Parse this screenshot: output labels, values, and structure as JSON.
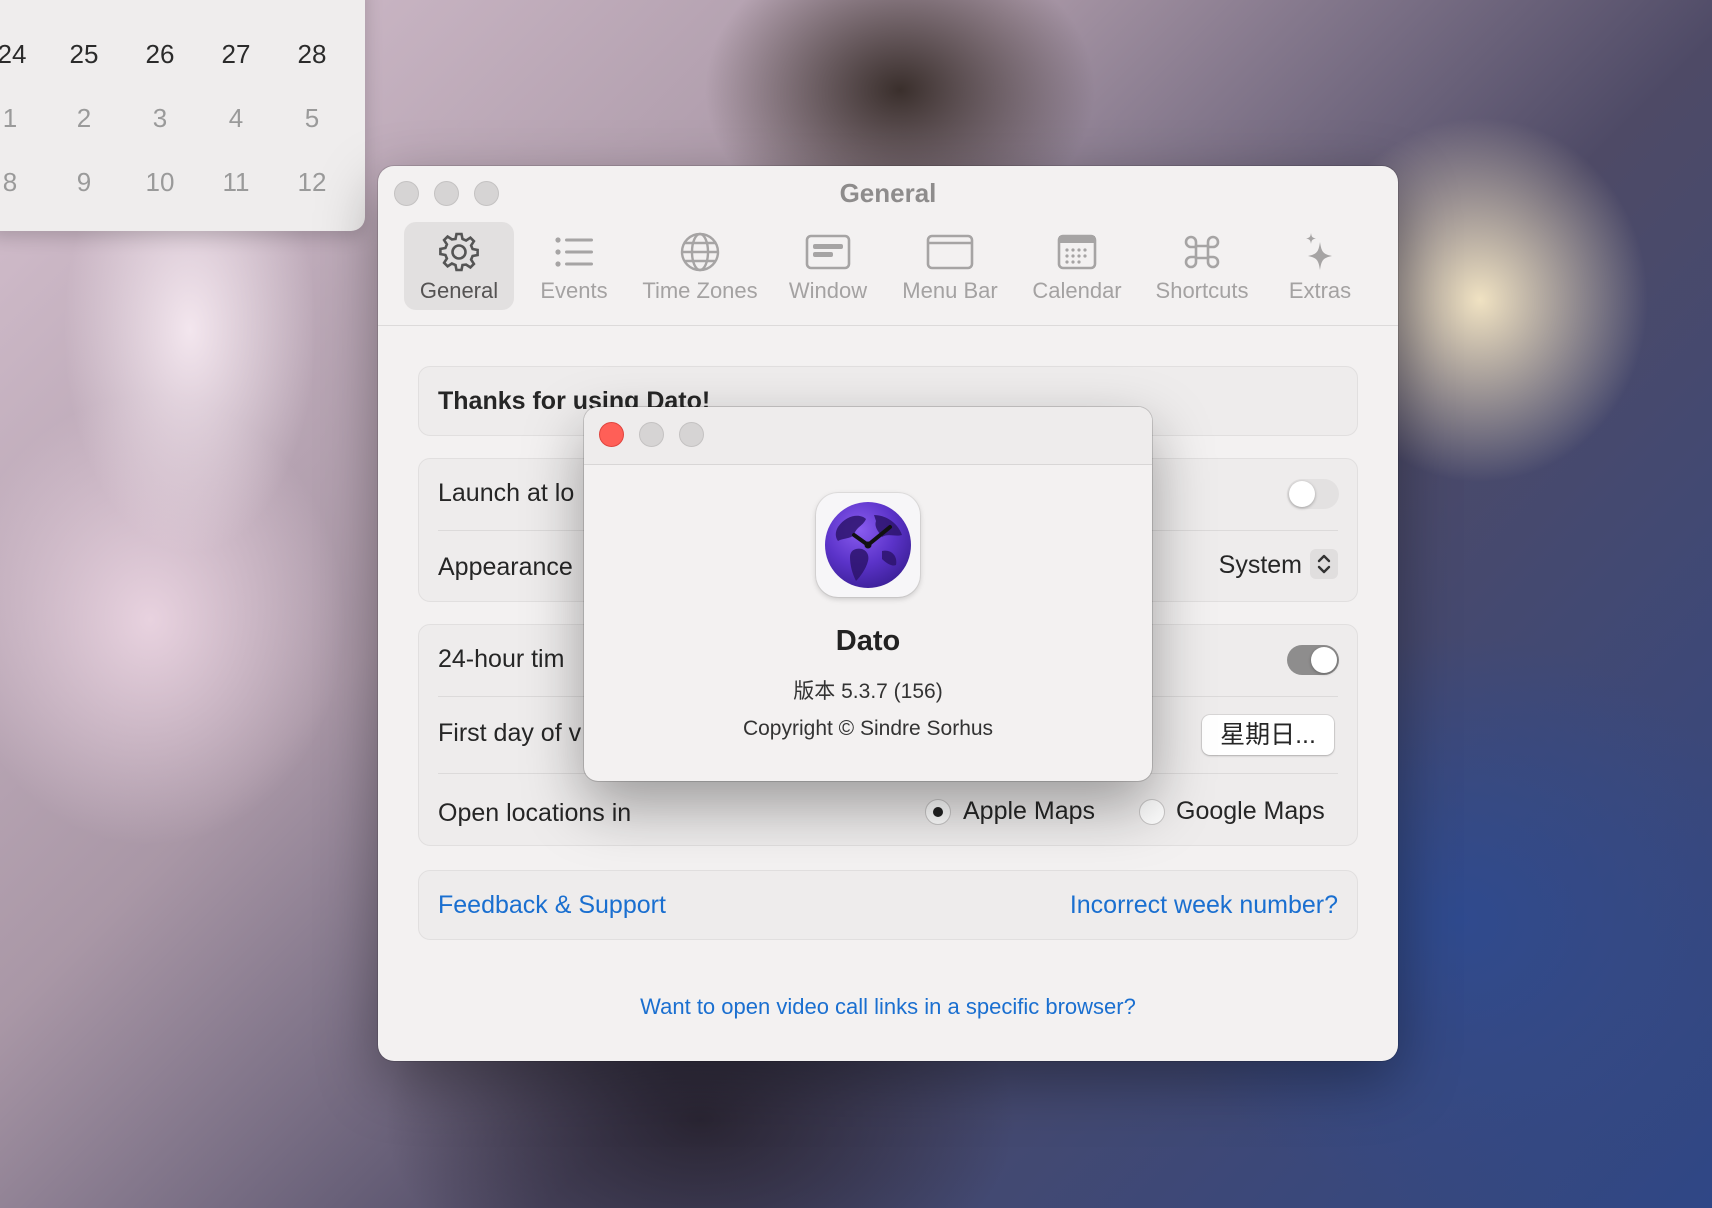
{
  "mini_calendar": {
    "weeks": [
      [
        {
          "day": "24",
          "muted": false
        },
        {
          "day": "25",
          "muted": false
        },
        {
          "day": "26",
          "muted": false
        },
        {
          "day": "27",
          "muted": false
        },
        {
          "day": "28",
          "muted": false
        }
      ],
      [
        {
          "day": "1",
          "muted": true
        },
        {
          "day": "2",
          "muted": true
        },
        {
          "day": "3",
          "muted": true
        },
        {
          "day": "4",
          "muted": true
        },
        {
          "day": "5",
          "muted": true
        }
      ],
      [
        {
          "day": "8",
          "muted": true
        },
        {
          "day": "9",
          "muted": true
        },
        {
          "day": "10",
          "muted": true
        },
        {
          "day": "11",
          "muted": true
        },
        {
          "day": "12",
          "muted": true
        }
      ]
    ]
  },
  "settings": {
    "title": "General",
    "tabs": [
      {
        "label": "General",
        "icon": "gear-icon",
        "active": true
      },
      {
        "label": "Events",
        "icon": "list-icon",
        "active": false
      },
      {
        "label": "Time Zones",
        "icon": "globe-icon",
        "active": false
      },
      {
        "label": "Window",
        "icon": "window-icon",
        "active": false
      },
      {
        "label": "Menu Bar",
        "icon": "menubar-icon",
        "active": false
      },
      {
        "label": "Calendar",
        "icon": "calendar-icon",
        "active": false
      },
      {
        "label": "Shortcuts",
        "icon": "command-icon",
        "active": false
      },
      {
        "label": "Extras",
        "icon": "sparkles-icon",
        "active": false
      }
    ],
    "thanks_text": "Thanks for using Dato!",
    "launch_label": "Launch at lo",
    "launch_on": false,
    "appearance_label": "Appearance",
    "appearance_value": "System",
    "hour24_label": "24-hour tim",
    "hour24_on": true,
    "first_day_label": "First day of v",
    "first_day_value": "星期日...",
    "open_locations_label": "Open locations in",
    "open_locations_options": [
      "Apple Maps",
      "Google Maps"
    ],
    "open_locations_selected": "Apple Maps",
    "feedback_link": "Feedback & Support",
    "week_number_link": "Incorrect week number?",
    "video_link": "Want to open video call links in a specific browser?"
  },
  "about": {
    "app_name": "Dato",
    "version": "版本 5.3.7 (156)",
    "copyright": "Copyright © Sindre Sorhus",
    "close_color": "#ff5f57"
  },
  "colors": {
    "link": "#1a6fd0",
    "toggle_on": "#8e8d8d",
    "toggle_off": "#e3e1e1"
  }
}
